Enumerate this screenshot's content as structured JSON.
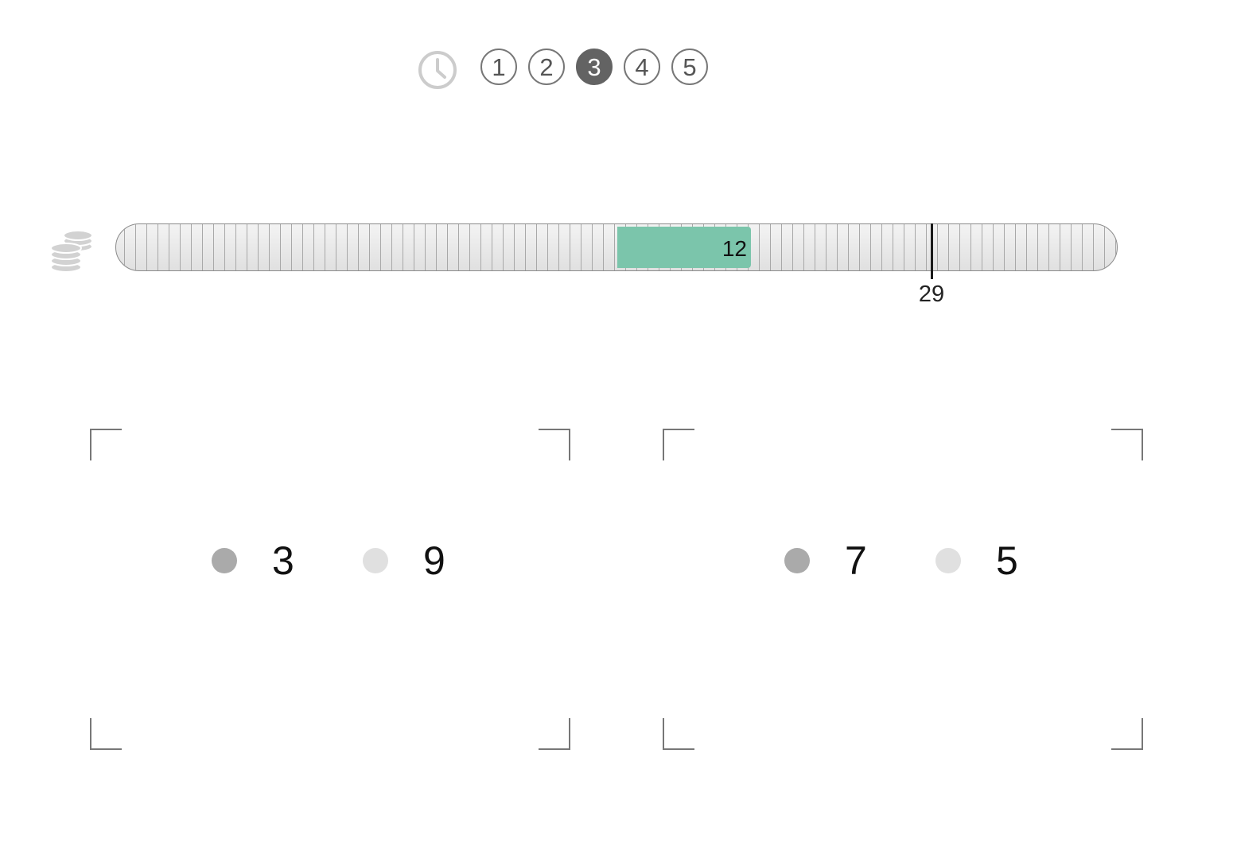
{
  "rounds": {
    "items": [
      "1",
      "2",
      "3",
      "4",
      "5"
    ],
    "current": "3"
  },
  "budget": {
    "value": "12",
    "target": "29",
    "fill_color": "#7bc5ab"
  },
  "options": [
    {
      "own": "3",
      "other": "9"
    },
    {
      "own": "7",
      "other": "5"
    }
  ],
  "icons": {
    "timer": "clock-icon",
    "budget": "coins-icon"
  },
  "colors": {
    "active_round": "#636363",
    "own_dot": "#aaaaaa",
    "other_dot": "#e0e0e0"
  }
}
